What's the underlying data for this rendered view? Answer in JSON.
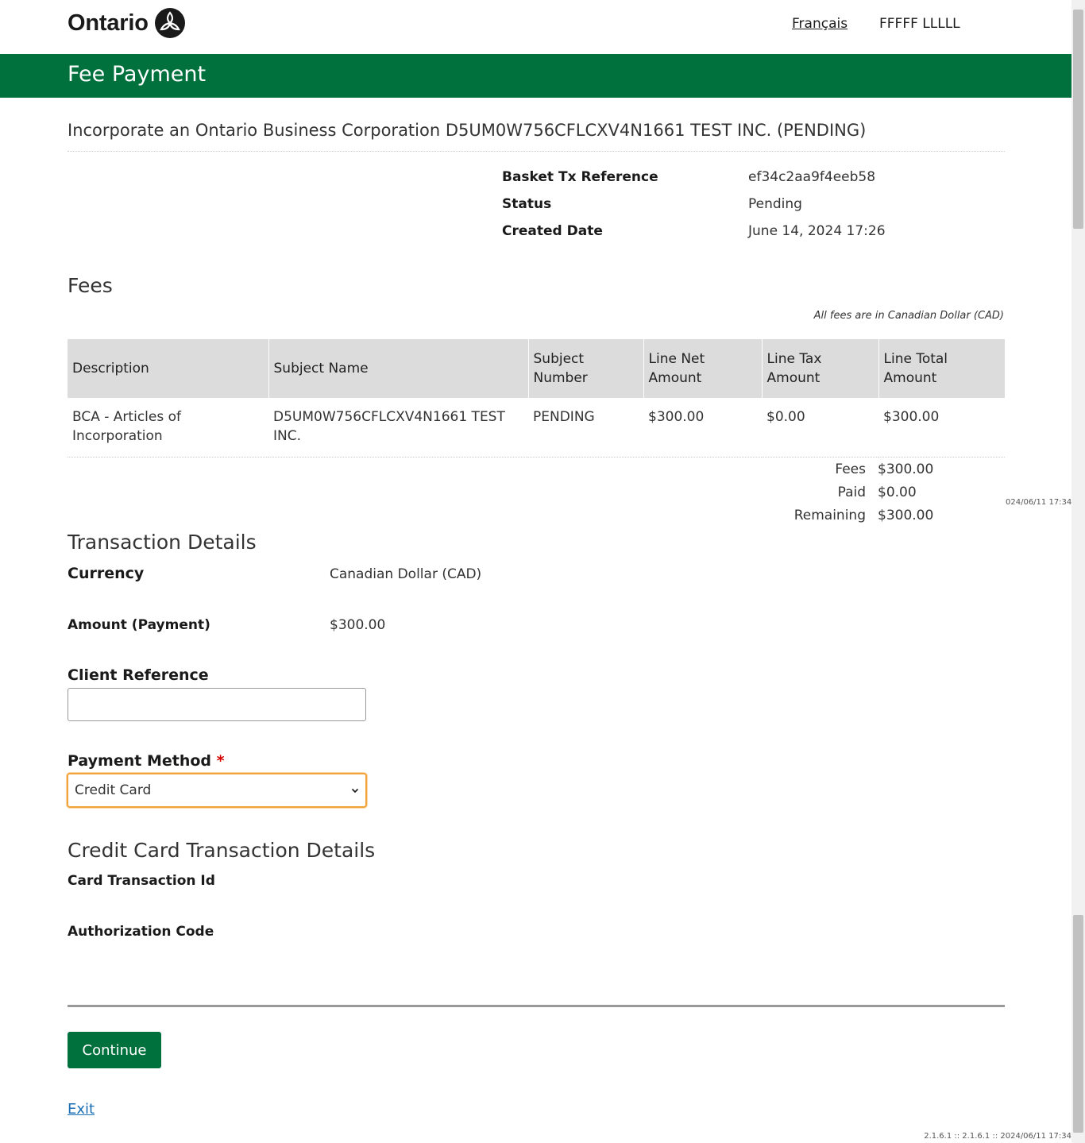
{
  "header": {
    "logo_text": "Ontario",
    "language_link": "Français",
    "user_name": "FFFFF LLLLL"
  },
  "banner": {
    "title": "Fee Payment"
  },
  "page_title": "Incorporate an Ontario Business Corporation D5UM0W756CFLCXV4N1661 TEST INC. (PENDING)",
  "meta": [
    {
      "label": "Basket Tx Reference",
      "value": "ef34c2aa9f4eeb58"
    },
    {
      "label": "Status",
      "value": "Pending"
    },
    {
      "label": "Created Date",
      "value": "June 14, 2024 17:26"
    }
  ],
  "fees": {
    "heading": "Fees",
    "note": "All fees are in Canadian Dollar (CAD)",
    "columns": [
      "Description",
      "Subject Name",
      "Subject Number",
      "Line Net Amount",
      "Line Tax Amount",
      "Line Total Amount"
    ],
    "rows": [
      [
        "BCA - Articles of Incorporation",
        "D5UM0W756CFLCXV4N1661 TEST INC.",
        "PENDING",
        "$300.00",
        "$0.00",
        "$300.00"
      ]
    ],
    "summary": [
      {
        "label": "Fees",
        "value": "$300.00"
      },
      {
        "label": "Paid",
        "value": "$0.00"
      },
      {
        "label": "Remaining",
        "value": "$300.00"
      }
    ]
  },
  "transaction": {
    "heading": "Transaction Details",
    "currency_label": "Currency",
    "currency_value": "Canadian Dollar (CAD)",
    "amount_label": "Amount (Payment)",
    "amount_value": "$300.00",
    "client_ref_label": "Client Reference",
    "client_ref_value": "",
    "payment_method_label": "Payment Method",
    "required_marker": "*",
    "payment_method_value": "Credit Card"
  },
  "credit_card": {
    "heading": "Credit Card Transaction Details",
    "card_tx_label": "Card Transaction Id",
    "auth_code_label": "Authorization Code"
  },
  "actions": {
    "continue_label": "Continue",
    "exit_label": "Exit"
  },
  "side_timestamp": "024/06/11 17:34",
  "footer_version": "2.1.6.1 :: 2.1.6.1 :: 2024/06/11 17:34",
  "colors": {
    "brand_green": "#00703c",
    "focus_orange": "#f2a33a",
    "required_red": "#d40000",
    "link_blue": "#1a6fb5"
  },
  "icons": [
    "ontario-trillium-icon",
    "chevron-down-icon",
    "arrow-down-icon",
    "arrow-up-icon"
  ]
}
